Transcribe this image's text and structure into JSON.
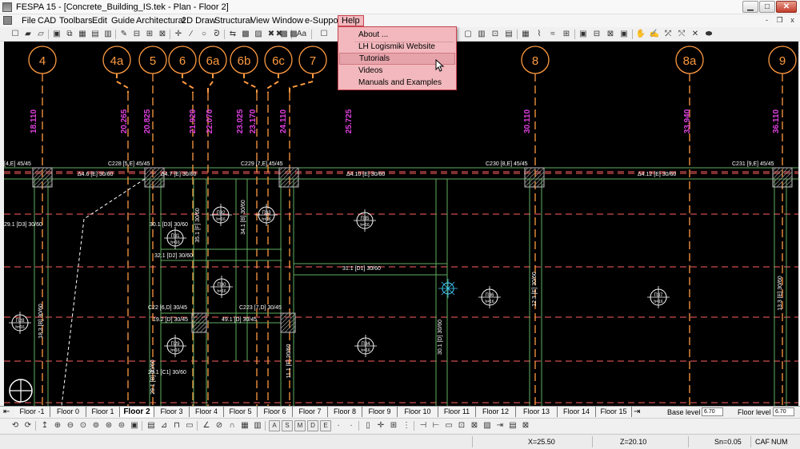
{
  "window": {
    "title": "FESPA 15 - [Concrete_Building_IS.tek - Plan - Floor 2]",
    "buttons": {
      "minimize": "▁",
      "maximize": "□",
      "close": "✕"
    },
    "mdi_buttons": {
      "minimize": "-",
      "restore": "❐",
      "close": "x"
    }
  },
  "menu": [
    "File",
    "CAD",
    "Toolbars",
    "Edit",
    "Guide",
    "Architectural",
    "2D Draw",
    "Structural",
    "View",
    "Window",
    "e-Support",
    "Help"
  ],
  "help_menu": {
    "items": [
      "About ...",
      "LH Logismiki Website",
      "Tutorials",
      "Videos",
      "Manuals and Examples"
    ],
    "highlighted": "Tutorials"
  },
  "toolbar1_left": [
    "☐",
    "▰",
    "▱",
    "▣",
    "⧉",
    "▦",
    "▤",
    "▥",
    "✎",
    "⊟",
    "⊞",
    "⊠",
    "✛",
    "∕",
    "○",
    "ᘐ",
    "⇆",
    "▩",
    "▨",
    "✖",
    "▩"
  ],
  "toolbar1_right": [
    "▢",
    "▥",
    "⊡",
    "▤",
    "▦",
    "⌇",
    "≈",
    "⊞",
    "▣",
    "⊟",
    "⊠",
    "▣",
    "✋",
    "✍",
    "⤱",
    "⤲",
    "✕",
    "⬬"
  ],
  "toolbar1_label": "Aa",
  "drawing": {
    "axes": [
      "4",
      "4a",
      "5",
      "6",
      "6a",
      "6b",
      "6c",
      "7",
      "8",
      "8a",
      "9"
    ],
    "levels": [
      "18.110",
      "20.265",
      "20.825",
      "21.920",
      "22.070",
      "23.025",
      "23.170",
      "24.110",
      "25.725",
      "30.110",
      "33.940",
      "36.110"
    ],
    "beam_labels": {
      "b_e_left": "[4,E] 45/45",
      "b46": "Δ4.6 [E] 30/60",
      "b47": "Δ4.7 [E] 30/60",
      "b410": "Δ4.10 [E] 30/60",
      "b412": "Δ4.12 [E] 30/60",
      "c228": "C228 [5,E] 45/45",
      "c229": "C229 [7,E] 45/45",
      "c230": "C230 [8,E] 45/45",
      "c231": "C231 [9,E] 45/45",
      "b29": "29.1 [D3] 30/60",
      "b30": "30.1 [D3] 30/60",
      "b32": "32.1 [D2] 30/60",
      "b31": "31.1 [D1] 30/60",
      "c222": "C22 [6,D] 30/45",
      "c223": "C223 [7,D] 30/45",
      "b192": "19.2 [D] 30/45",
      "b491": "49.1 [D] 30/45",
      "b291": "29.1 [C1] 30/60",
      "v30": "34.1 [B] 30/60",
      "v35": "35.1 [F] 30/60",
      "v36": "12.3 [E] 30/60",
      "v37": "13.3 [E] 30/60",
      "v38": "30.1 [D] 30/60",
      "v39": "11.1 [F] 30/60",
      "v40": "29.1 [B] 30/60",
      "v41": "18.3 [B] 30/60"
    },
    "slabs": [
      {
        "id": "Π32",
        "h": "h=16"
      },
      {
        "id": "Π33",
        "h": "h=16"
      },
      {
        "id": "Π35",
        "h": "h=16"
      },
      {
        "id": "Π31",
        "h": "h=16"
      },
      {
        "id": "Π30",
        "h": "h=16"
      },
      {
        "id": "Π36",
        "h": "h=16"
      },
      {
        "id": "Π37",
        "h": "h=16"
      },
      {
        "id": "Π29",
        "h": "h=16"
      },
      {
        "id": "Π34",
        "h": "h=16"
      },
      {
        "id": "Π28",
        "h": "h=16"
      }
    ],
    "colors": {
      "bubble": "#ff9a40",
      "level": "#e040e0",
      "beam": "#ff5050",
      "grid": "#ff6060",
      "green": "#5fae5f",
      "column": "#909090",
      "cyan": "#40d0ff",
      "white": "#ffffff"
    }
  },
  "floor_tabs": [
    "Floor -1",
    "Floor 0",
    "Floor 1",
    "Floor 2",
    "Floor 3",
    "Floor 4",
    "Floor 5",
    "Floor 6",
    "Floor 7",
    "Floor 8",
    "Floor 9",
    "Floor 10",
    "Floor 11",
    "Floor 12",
    "Floor 13",
    "Floor 14",
    "Floor 15"
  ],
  "active_floor": "Floor 2",
  "base_level_label": "Base level",
  "base_level_value": "6.70",
  "floor_level_label": "Floor level",
  "floor_level_value": "6.70",
  "bottom_toolbar": [
    "⟲",
    "⟳",
    "↥",
    "⊕",
    "⊖",
    "⊙",
    "⊚",
    "⊛",
    "⊜",
    "▣",
    "▤",
    "⊿",
    "⊓",
    "▭",
    "∠",
    "⊘",
    "∩",
    "▦",
    "▥",
    "A",
    "S",
    "M",
    "D",
    "E",
    "∙",
    "∙",
    "▯",
    "✛",
    "⊞",
    "⋮",
    "⊣",
    "⊢",
    "▭",
    "⊡",
    "⊠",
    "▨",
    "⇥",
    "▤",
    "⊠"
  ],
  "status": {
    "x": "X=25.50",
    "z": "Z=20.10",
    "sn": "Sn=0.05",
    "caf": "CAF",
    "num": "NUM"
  }
}
